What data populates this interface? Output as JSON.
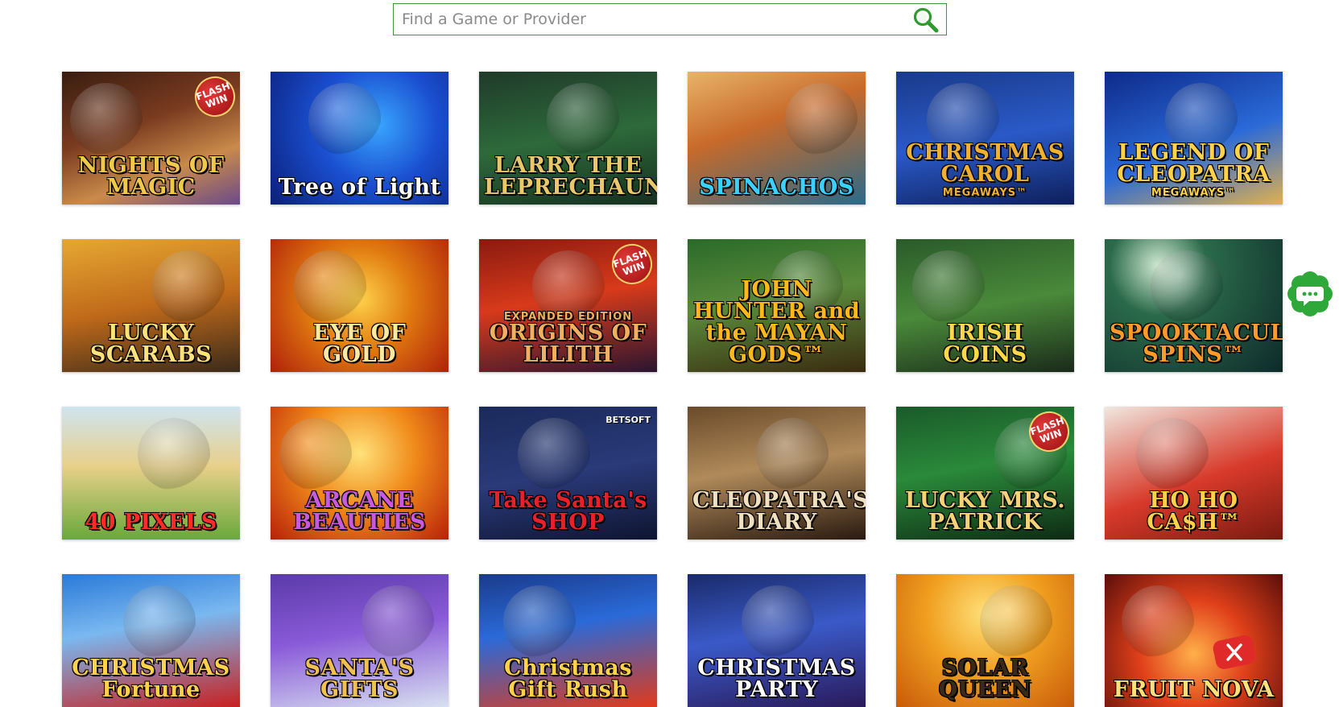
{
  "search": {
    "placeholder": "Find a Game or Provider",
    "value": ""
  },
  "games": [
    {
      "title": "NIGHTS OF MAGIC",
      "badge": "FLASH WIN",
      "bg": "linear-gradient(160deg,#3a1d10 0%,#7a3b20 40%,#c98a4a 70%,#6a4a8a 100%)",
      "color": "#f1c94a"
    },
    {
      "title": "Tree of Light",
      "bg": "radial-gradient(circle at 60% 40%,#3aa6ff 0%,#1a4fd0 45%,#0b1f7a 100%)",
      "color": "#ffffff"
    },
    {
      "title": "LARRY THE LEPRECHAUN",
      "bg": "linear-gradient(170deg,#1f3a2a 0%,#2d6a3a 50%,#163020 100%)",
      "color": "#e9c86a"
    },
    {
      "title": "SPINACHOS",
      "bg": "linear-gradient(160deg,#e8b46a 0%,#c86a2a 40%,#2a6a8a 100%)",
      "color": "#3ad0ff"
    },
    {
      "title": "CHRISTMAS CAROL",
      "subtitle": "MEGAWAYS™",
      "bg": "linear-gradient(170deg,#1a3a8a 0%,#2a5ac8 50%,#0e1f5a 100%)",
      "color": "#f0b030"
    },
    {
      "title": "LEGEND OF CLEOPATRA",
      "subtitle": "MEGAWAYS™",
      "bg": "linear-gradient(160deg,#0e2a8a 0%,#2a6ad8 55%,#e0b050 100%)",
      "color": "#ffd24a"
    },
    {
      "title": "LUCKY SCARABS",
      "bg": "linear-gradient(170deg,#e6a832 0%,#c06a1a 50%,#3a2a1a 100%)",
      "color": "#ffe27a"
    },
    {
      "title": "EYE OF GOLD",
      "bg": "radial-gradient(circle at 50% 45%,#ffd24a 0%,#e07a10 45%,#b0200a 100%)",
      "color": "#ffe9a0"
    },
    {
      "title": "ORIGINS OF LILITH",
      "subtitle": "EXPANDED EDITION",
      "badge": "FLASH WIN",
      "bg": "linear-gradient(170deg,#8a1a10 0%,#d83a1a 45%,#2a1530 100%)",
      "color": "#f0b060"
    },
    {
      "title": "JOHN HUNTER and the MAYAN GODS™",
      "bg": "linear-gradient(170deg,#2a6a2a 0%,#5a8a3a 45%,#3a2a10 100%)",
      "color": "#ffb81a"
    },
    {
      "title": "IRISH COINS",
      "bg": "linear-gradient(170deg,#2a5a2a 0%,#4a8a3a 50%,#1a2a1a 100%)",
      "color": "#ffd84a"
    },
    {
      "title": "SPOOKTACULAR SPINS™",
      "bg": "radial-gradient(circle at 30% 20%,#cfe8d0 0%,#2a6a4a 30%,#0e2a2a 100%)",
      "color": "#ff9a2a"
    },
    {
      "title": "40 PIXELS",
      "bg": "linear-gradient(180deg,#cfe4f0 0%,#e8d08a 45%,#6aa83a 100%)",
      "color": "#ff2a2a"
    },
    {
      "title": "ARCANE BEAUTIES",
      "bg": "radial-gradient(circle at 50% 35%,#ffe27a 0%,#f08a1a 45%,#b8200a 100%)",
      "color": "#c85adf"
    },
    {
      "title": "Take Santa's SHOP",
      "provider": "BETSOFT",
      "bg": "linear-gradient(170deg,#1a2a5a 0%,#2a3a7a 50%,#0e1530 100%)",
      "color": "#e8202a"
    },
    {
      "title": "CLEOPATRA'S DIARY",
      "bg": "linear-gradient(170deg,#6a4a2a 0%,#b08a5a 45%,#2a1a10 100%)",
      "color": "#f0e0c0"
    },
    {
      "title": "LUCKY MRS. PATRICK",
      "badge": "FLASH WIN",
      "bg": "linear-gradient(170deg,#1a5a2a 0%,#2a8a3a 45%,#0e2a14 100%)",
      "color": "#f3d27a"
    },
    {
      "title": "HO HO CA$H™",
      "bg": "linear-gradient(160deg,#f0e8e0 0%,#d83a2a 55%,#7a1a10 100%)",
      "color": "#ffd24a"
    },
    {
      "title": "CHRISTMAS Fortune",
      "bg": "linear-gradient(170deg,#2a7ad8 0%,#7ab8f0 40%,#c82020 100%)",
      "color": "#ffd24a"
    },
    {
      "title": "SANTA'S GIFTS",
      "bg": "linear-gradient(170deg,#5a3aa8 0%,#8a5ad8 45%,#d8e0f0 100%)",
      "color": "#f0c050"
    },
    {
      "title": "Christmas Gift Rush",
      "bg": "linear-gradient(170deg,#1a3a8a 0%,#2a6ad8 40%,#e03a1a 100%)",
      "color": "#ffd24a"
    },
    {
      "title": "CHRISTMAS PARTY",
      "bg": "linear-gradient(170deg,#1a2a6a 0%,#3a5ac8 45%,#2a1a5a 100%)",
      "color": "#ffffff"
    },
    {
      "title": "SOLAR QUEEN",
      "bg": "radial-gradient(circle at 50% 30%,#ffe07a 0%,#f0a020 45%,#c85a0a 100%)",
      "color": "#3a2a1a"
    },
    {
      "title": "FRUIT NOVA",
      "bg": "radial-gradient(circle at 50% 60%,#ffb04a 0%,#e0401a 45%,#5a0e0a 100%)",
      "color": "#ffe07a"
    }
  ]
}
